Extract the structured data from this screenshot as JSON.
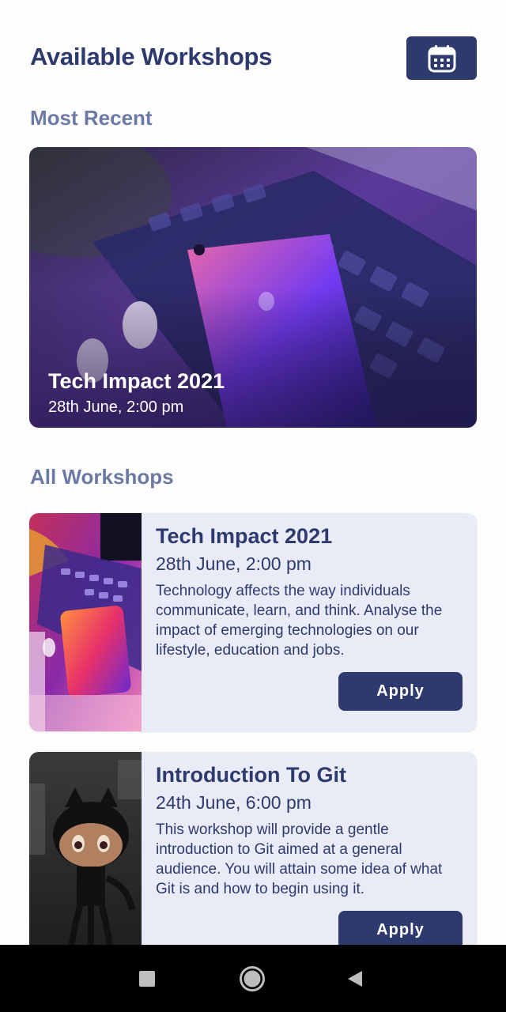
{
  "header": {
    "title": "Available Workshops",
    "calendar_icon": "calendar-icon"
  },
  "sections": {
    "recent_title": "Most Recent",
    "all_title": "All Workshops"
  },
  "featured": {
    "title": "Tech Impact 2021",
    "date": "28th June, 2:00 pm",
    "image": "laptop-and-phone-photo"
  },
  "workshops": [
    {
      "title": "Tech Impact 2021",
      "date": "28th June, 2:00 pm",
      "description": "Technology affects the way individuals communicate, learn, and think. Analyse the impact of emerging technologies on our lifestyle, education and jobs.",
      "apply_label": "Apply",
      "image": "laptop-and-phone-photo"
    },
    {
      "title": "Introduction To Git",
      "date": "24th June, 6:00 pm",
      "description": "This workshop will provide a gentle introduction to Git aimed at a general audience. You will attain some idea of what Git is and how to begin using it.",
      "apply_label": "Apply",
      "image": "octocat-figurine-photo"
    }
  ],
  "navigation": {
    "recents_icon": "square-icon",
    "home_icon": "circle-icon",
    "back_icon": "back-triangle-icon"
  },
  "colors": {
    "primary": "#2e3a6e",
    "section_heading": "#6c7aa3",
    "card_background": "#e9ecf6",
    "nav_bar": "#000000"
  }
}
